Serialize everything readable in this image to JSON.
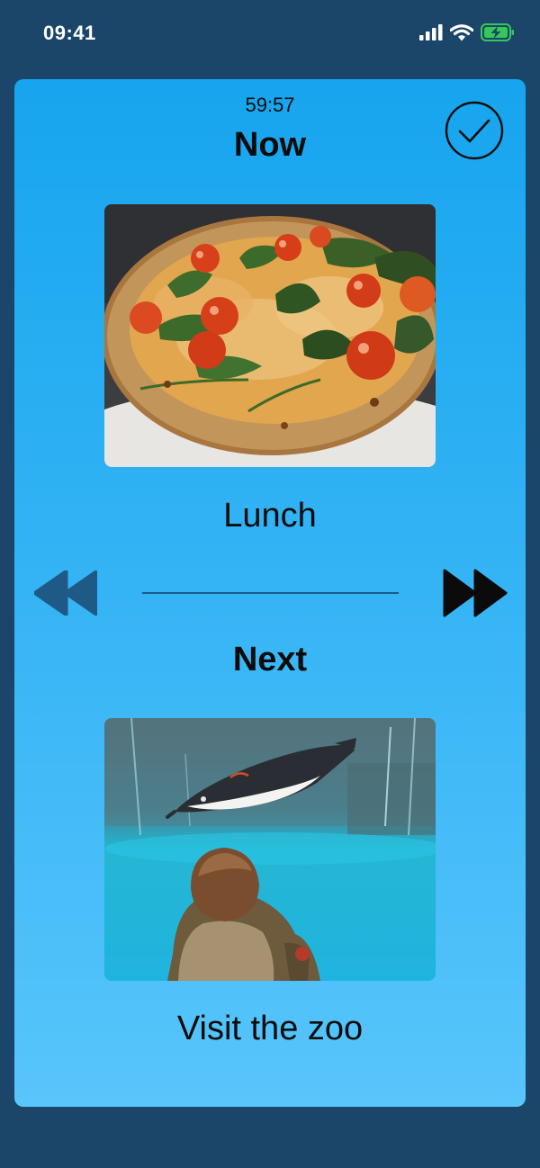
{
  "status_bar": {
    "time": "09:41",
    "icons": [
      "cellular-signal-icon",
      "wifi-icon",
      "battery-charging-icon"
    ],
    "battery_color": "#35c759"
  },
  "schedule": {
    "timer": "59:57",
    "now": {
      "heading": "Now",
      "label": "Lunch",
      "image": "pizza-photo"
    },
    "next": {
      "heading": "Next",
      "label": "Visit the zoo",
      "image": "zoo-penguin-photo"
    }
  },
  "controls": {
    "done_icon": "checkmark-circle-icon",
    "previous_icon": "rewind-icon",
    "next_icon": "fast-forward-icon"
  },
  "colors": {
    "background": "#1b4669",
    "card_top": "#16a5ee",
    "card_bottom": "#58c5fb",
    "previous_disabled": "#1e5a85",
    "text": "#0b0b0b"
  }
}
